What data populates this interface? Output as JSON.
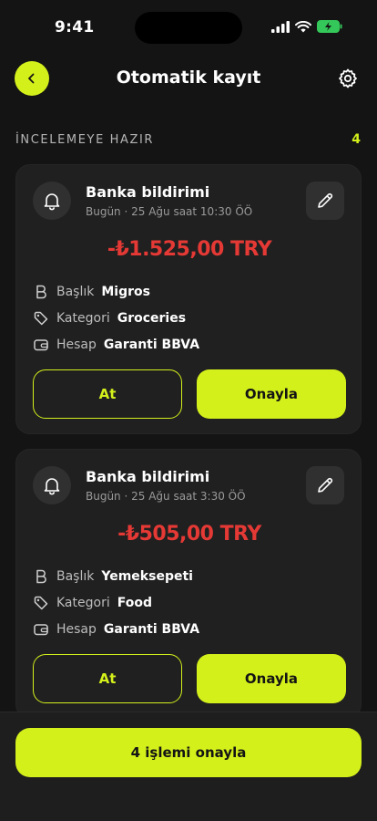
{
  "status_bar": {
    "time": "9:41"
  },
  "header": {
    "title": "Otomatik kayıt"
  },
  "section": {
    "label": "İNCELEMEYE HAZIR",
    "count": "4"
  },
  "cards": [
    {
      "title": "Banka bildirimi",
      "subtitle": "Bugün · 25 Ağu saat 10:30 ÖÖ",
      "amount": "-₺1.525,00 TRY",
      "details": [
        {
          "label": "Başlık",
          "value": "Migros",
          "icon": "letter-b-icon"
        },
        {
          "label": "Kategori",
          "value": "Groceries",
          "icon": "tag-icon"
        },
        {
          "label": "Hesap",
          "value": "Garanti BBVA",
          "icon": "wallet-icon"
        }
      ],
      "dismiss_label": "At",
      "approve_label": "Onayla"
    },
    {
      "title": "Banka bildirimi",
      "subtitle": "Bugün · 25 Ağu saat 3:30 ÖÖ",
      "amount": "-₺505,00 TRY",
      "details": [
        {
          "label": "Başlık",
          "value": "Yemeksepeti",
          "icon": "letter-b-icon"
        },
        {
          "label": "Kategori",
          "value": "Food",
          "icon": "tag-icon"
        },
        {
          "label": "Hesap",
          "value": "Garanti BBVA",
          "icon": "wallet-icon"
        }
      ],
      "dismiss_label": "At",
      "approve_label": "Onayla"
    }
  ],
  "footer": {
    "approve_all_label": "4 işlemi onayla"
  },
  "colors": {
    "accent": "#d4f01b",
    "negative": "#e53935",
    "background": "#141414",
    "card": "#202020"
  }
}
